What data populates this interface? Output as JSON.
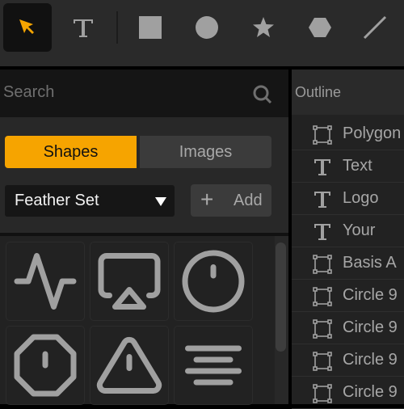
{
  "toolbar": {
    "tools": [
      {
        "name": "select",
        "active": true
      },
      {
        "name": "text"
      },
      {
        "name": "rectangle"
      },
      {
        "name": "ellipse"
      },
      {
        "name": "star"
      },
      {
        "name": "hexagon"
      },
      {
        "name": "line"
      }
    ],
    "accent": "#f6a400"
  },
  "search": {
    "placeholder": "Search",
    "value": ""
  },
  "tabs": [
    {
      "label": "Shapes",
      "active": true
    },
    {
      "label": "Images",
      "active": false
    }
  ],
  "set_dropdown": {
    "selected": "Feather Set"
  },
  "add_button": {
    "label": "Add"
  },
  "icon_grid": [
    "activity",
    "airplay",
    "alert-circle",
    "alert-octagon",
    "alert-triangle",
    "align-center"
  ],
  "outline": {
    "title": "Outline",
    "items": [
      {
        "type": "group",
        "label": "Polygon"
      },
      {
        "type": "text",
        "label": "Text"
      },
      {
        "type": "text",
        "label": "Logo"
      },
      {
        "type": "text",
        "label": "Your"
      },
      {
        "type": "group",
        "label": "Basis A"
      },
      {
        "type": "group",
        "label": "Circle 9"
      },
      {
        "type": "group",
        "label": "Circle 9"
      },
      {
        "type": "group",
        "label": "Circle 9"
      },
      {
        "type": "group",
        "label": "Circle 9"
      }
    ]
  }
}
